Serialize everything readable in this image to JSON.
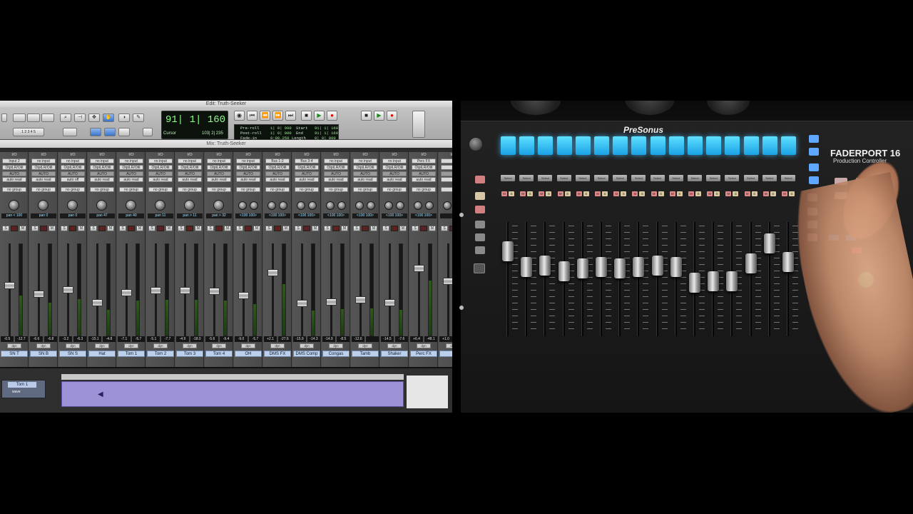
{
  "pro_tools": {
    "edit_window_title": "Edit: Truth-Seeker",
    "mix_window_title": "Mix: Truth-Seeker",
    "counter_main": "91| 1| 160",
    "cursor_label": "Cursor",
    "cursor_value": "103| 2| 235",
    "transport": {
      "preroll_label": "Pre-roll",
      "preroll_value": "1| 0| 000",
      "postroll_label": "Post-roll",
      "postroll_value": "1| 0| 000",
      "fadein_label": "Fade-in",
      "fadein_value": "0:00.250",
      "start_label": "Start",
      "start_value": "91| 1| 160",
      "end_label": "End",
      "end_value": "91| 1| 160",
      "length_label": "Length",
      "length_value": "0| 0| 000"
    },
    "strips": [
      {
        "io": "I/O",
        "input": "Input 2",
        "output": "OtptLR/Otlt",
        "auto": "AUTO",
        "mode": "auto read",
        "group": "no group",
        "pan": "pan < 100",
        "vol": "-0.5",
        "peak": "-12.7",
        "name": "SN T",
        "fader": 0.55
      },
      {
        "io": "I/O",
        "input": "no input",
        "output": "OtptLR/Otlt",
        "auto": "AUTO",
        "mode": "auto read",
        "group": "no group",
        "pan": "pan 0",
        "vol": "-6.6",
        "peak": "-6.8",
        "name": "SN B",
        "fader": 0.45
      },
      {
        "io": "I/O",
        "input": "no input",
        "output": "OtptLR/Otlt",
        "auto": "AUTO",
        "mode": "auto off",
        "group": "no group",
        "pan": "pan 0",
        "vol": "-3.2",
        "peak": "-6.3",
        "name": "SN S",
        "fader": 0.5
      },
      {
        "io": "I/O",
        "input": "no input",
        "output": "OtptLR/Otlt",
        "auto": "AUTO",
        "mode": "auto read",
        "group": "no group",
        "pan": "pan 47",
        "vol": "-15.1",
        "peak": "-4.8",
        "name": "Hat",
        "fader": 0.35
      },
      {
        "io": "I/O",
        "input": "no input",
        "output": "OtptLR/Otlt",
        "auto": "AUTO",
        "mode": "auto read",
        "group": "no group",
        "pan": "pan 40",
        "vol": "-7.1",
        "peak": "-5.7",
        "name": "Tom 1",
        "fader": 0.47
      },
      {
        "io": "I/O",
        "input": "no input",
        "output": "OtptLR/Otlt",
        "auto": "AUTO",
        "mode": "auto read",
        "group": "no group",
        "pan": "pan 11",
        "vol": "-5.1",
        "peak": "-7.7",
        "name": "Tom 2",
        "fader": 0.49
      },
      {
        "io": "I/O",
        "input": "no input",
        "output": "OtptLR/Otlt",
        "auto": "AUTO",
        "mode": "auto read",
        "group": "no group",
        "pan": "pan > 11",
        "vol": "-4.9",
        "peak": "-18.0",
        "name": "Tom 3",
        "fader": 0.49
      },
      {
        "io": "I/O",
        "input": "no input",
        "output": "OtptLR/Otlt",
        "auto": "AUTO",
        "mode": "auto read",
        "group": "no group",
        "pan": "pan > 32",
        "vol": "-5.6",
        "peak": "-9.4",
        "name": "Tom 4",
        "fader": 0.48
      },
      {
        "io": "I/O",
        "input": "no input",
        "output": "OtptLR/Otlt",
        "auto": "AUTO",
        "mode": "auto read",
        "group": "no group",
        "pan": "<100 100>",
        "vol": "-9.0",
        "peak": "-5.7",
        "name": "OH",
        "fader": 0.43
      },
      {
        "io": "I/O",
        "input": "Bus 1-2",
        "output": "OtptLR/Otlt",
        "auto": "AUTO",
        "mode": "auto read",
        "group": "no group",
        "pan": "<100 100>",
        "vol": "+2.1",
        "peak": "-27.6",
        "name": "DMS FX",
        "fader": 0.7
      },
      {
        "io": "I/O",
        "input": "Bus 3-4",
        "output": "OtptLR/Otlt",
        "auto": "AUTO",
        "mode": "auto read",
        "group": "no group",
        "pan": "<100 100>",
        "vol": "-15.9",
        "peak": "-14.3",
        "name": "DMS Comp",
        "fader": 0.34
      },
      {
        "io": "I/O",
        "input": "no input",
        "output": "OtptLR/Otlt",
        "auto": "AUTO",
        "mode": "auto read",
        "group": "no group",
        "pan": "<100 100>",
        "vol": "-14.9",
        "peak": "-8.5",
        "name": "Congas",
        "fader": 0.36
      },
      {
        "io": "I/O",
        "input": "no input",
        "output": "OtptLR/Otlt",
        "auto": "AUTO",
        "mode": "auto read",
        "group": "no group",
        "pan": "<100 100>",
        "vol": "-12.6",
        "peak": "",
        "name": "Tamb",
        "fader": 0.38
      },
      {
        "io": "I/O",
        "input": "no input",
        "output": "OtptLR/Otlt",
        "auto": "AUTO",
        "mode": "auto read",
        "group": "no group",
        "pan": "<100 100>",
        "vol": "-14.5",
        "peak": "-7.6",
        "name": "Shaker",
        "fader": 0.35
      },
      {
        "io": "I/O",
        "input": "Perc FX",
        "output": "OtptLR/Otlt",
        "auto": "AUTO",
        "mode": "auto read",
        "group": "no group",
        "pan": "<100 100>",
        "vol": "+6.4",
        "peak": "-48.1",
        "name": "Perc FX",
        "fader": 0.75
      },
      {
        "io": "I/O",
        "input": "",
        "output": "",
        "auto": "",
        "mode": "",
        "group": "",
        "pan": "",
        "vol": "+1.0",
        "peak": "",
        "name": "",
        "fader": 0.6
      }
    ],
    "edit_track_name": "Tom 1",
    "edit_track_mode": "wave"
  },
  "faderport": {
    "brand": "PreSonus",
    "model": "FADERPORT 16",
    "subtitle": "Production Controller",
    "select_label": "Select",
    "channel_count": 16,
    "fader_levels": [
      0.8,
      0.6,
      0.62,
      0.55,
      0.58,
      0.6,
      0.58,
      0.6,
      0.62,
      0.6,
      0.4,
      0.42,
      0.42,
      0.65,
      0.9,
      0.66
    ],
    "pad_color": "#2ab4f0"
  },
  "colors": {
    "track_name_bg": "#bcd0ec",
    "pad_glow": "#5fe0ff",
    "counter_green": "#8fff86"
  }
}
